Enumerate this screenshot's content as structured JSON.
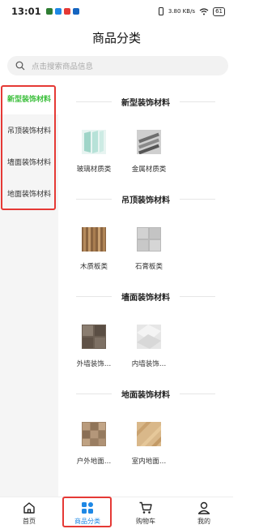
{
  "status": {
    "time": "13:01",
    "speed": "3.80 KB/s",
    "battery": "61"
  },
  "header": {
    "title": "商品分类"
  },
  "search": {
    "placeholder": "点击搜索商品信息"
  },
  "sidebar": {
    "items": [
      {
        "label": "新型装饰材料",
        "active": true
      },
      {
        "label": "吊顶装饰材料",
        "active": false
      },
      {
        "label": "墙面装饰材料",
        "active": false
      },
      {
        "label": "地面装饰材料",
        "active": false
      }
    ]
  },
  "sections": [
    {
      "title": "新型装饰材料",
      "items": [
        {
          "label": "玻璃材质类"
        },
        {
          "label": "金属材质类"
        }
      ]
    },
    {
      "title": "吊顶装饰材料",
      "items": [
        {
          "label": "木质板类"
        },
        {
          "label": "石膏板类"
        }
      ]
    },
    {
      "title": "墙面装饰材料",
      "items": [
        {
          "label": "外墙装饰…"
        },
        {
          "label": "内墙装饰…"
        }
      ]
    },
    {
      "title": "地面装饰材料",
      "items": [
        {
          "label": "户外地面…"
        },
        {
          "label": "室内地面…"
        }
      ]
    }
  ],
  "tabbar": {
    "items": [
      {
        "label": "首页",
        "icon": "home-icon"
      },
      {
        "label": "商品分类",
        "icon": "category-icon"
      },
      {
        "label": "购物车",
        "icon": "cart-icon"
      },
      {
        "label": "我的",
        "icon": "user-icon"
      }
    ]
  },
  "colors": {
    "active_green": "#3cbf3c",
    "active_blue": "#1e88e5",
    "highlight_red": "#e53935"
  }
}
